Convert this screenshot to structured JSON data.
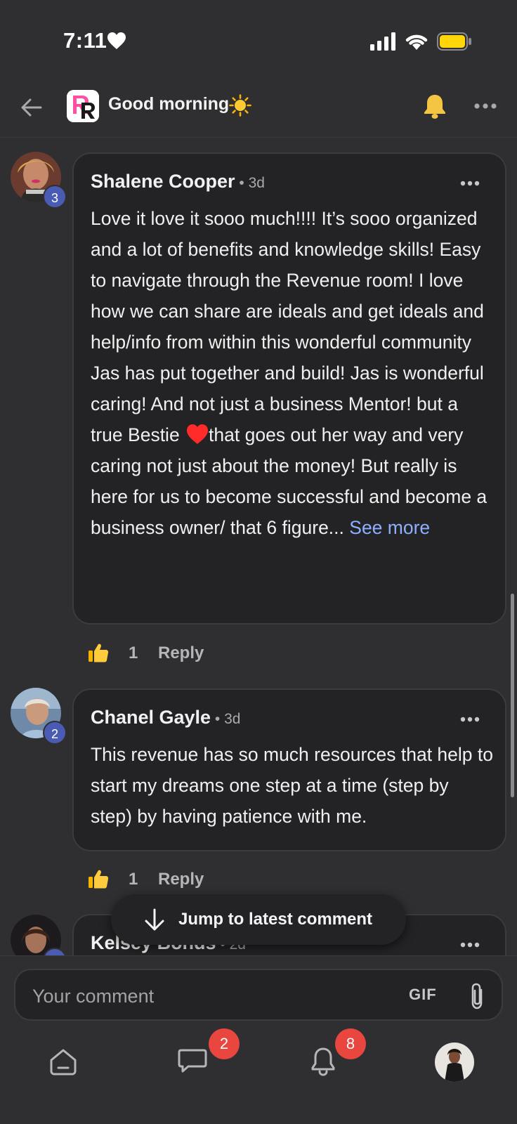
{
  "status_bar": {
    "time": "7:11"
  },
  "header": {
    "title": "Good morning"
  },
  "comments": [
    {
      "author": "Shalene Cooper",
      "sep": " • ",
      "time": "3d",
      "badge": "3",
      "text_before": "Love it love it sooo much!!!! It’s sooo organized and a lot of benefits and knowledge skills! Easy to navigate through the Revenue room! I love how we can share are ideals and get ideals and help/info from within this wonderful community Jas has put together and build! Jas is wonderful caring! And not just a business Mentor! but a true Bestie ",
      "text_after": "that goes out her way and very caring not just about the money! But really is here for us to become successful and become a business owner/ that 6 figure... ",
      "see_more": "See more",
      "likes": "1",
      "reply": "Reply"
    },
    {
      "author": "Chanel Gayle",
      "sep": " • ",
      "time": "3d",
      "badge": "2",
      "text": "This revenue has so much resources that help to start my dreams one step at a time (step by step) by having patience with me.",
      "likes": "1",
      "reply": "Reply"
    },
    {
      "author": "Kelsey Bonds",
      "sep": " • ",
      "time": "2d"
    }
  ],
  "jump_button": {
    "label": "Jump to latest comment"
  },
  "composer": {
    "placeholder": "Your comment",
    "gif_label": "GIF"
  },
  "bottom_nav": {
    "messages_badge": "2",
    "notifications_badge": "8"
  },
  "colors": {
    "link": "#8cb0ff",
    "badge_red": "#e8463f",
    "avatar_badge": "#4a5bb4",
    "bell": "#f4c542"
  }
}
